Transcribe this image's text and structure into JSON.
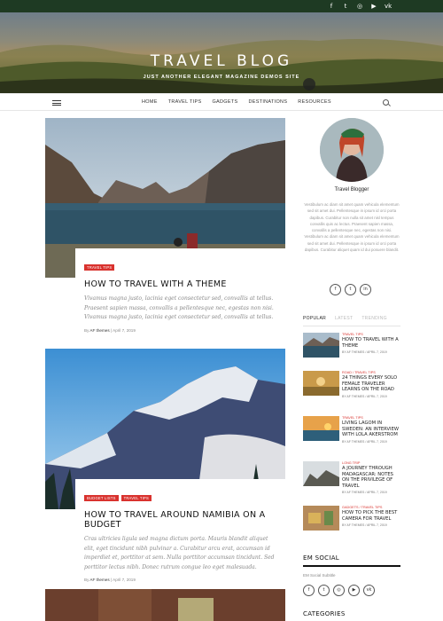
{
  "site": {
    "title": "TRAVEL BLOG",
    "tagline": "JUST ANOTHER ELEGANT MAGAZINE DEMOS SITE",
    "top_social_icons": [
      "facebook-icon",
      "twitter-icon",
      "instagram-icon",
      "youtube-icon",
      "vk-icon"
    ]
  },
  "nav": {
    "items": [
      "HOME",
      "TRAVEL TIPS",
      "GADGETS",
      "DESTINATIONS",
      "RESOURCES"
    ]
  },
  "posts": [
    {
      "tags": [
        "TRAVEL TIPS"
      ],
      "title": "HOW TO TRAVEL WITH A THEME",
      "excerpt": "Vivamus magna justo, lacinia eget consectetur sed, convallis at tellus. Praesent sapien massa, convallis a pellentesque nec, egestas non nisi. Vivamus magna justo, lacinia eget consectetur sed, convallis at tellus.",
      "author_prefix": "By",
      "author": "AF themes",
      "date": "April 7, 2019"
    },
    {
      "tags": [
        "BUDGET LISTS",
        "TRAVEL TIPS"
      ],
      "title": "HOW TO TRAVEL AROUND NAMIBIA ON A BUDGET",
      "excerpt": "Cras ultricies ligula sed magna dictum porta. Mauris blandit aliquet elit, eget tincidunt nibh pulvinar a. Curabitur arcu erat, accumsan id imperdiet et, porttitor at sem. Nulla porttitor accumsan tincidunt. Sed porttitor lectus nibh. Donec rutrum congue leo eget malesuada.",
      "author_prefix": "By",
      "author": "AF themes",
      "date": "April 7, 2019"
    }
  ],
  "sidebar": {
    "about": {
      "name": "Travel Blogger",
      "text": "Vestibulum ac diam sit amet quam vehicula elementum sed sit amet dui. Pellentesque in ipsum id orci porta dapibus. Curabitur non nulla sit amet nisl tempus convallis quis ac lectus. Praesent sapien massa, convallis a pellentesque nec, egestas non nisi. Vestibulum ac diam sit amet quam vehicula elementum sed sit amet dui. Pellentesque in ipsum id orci porta dapibus. Curabitur aliquet quam id dui posuere blandit.",
      "social_icons": [
        "facebook-icon",
        "twitter-icon",
        "linkedin-icon"
      ]
    },
    "tabs": [
      "POPULAR",
      "LATEST",
      "TRENDING"
    ],
    "popular": [
      {
        "cat": "TRAVEL TIPS",
        "title": "HOW TO TRAVEL WITH A THEME",
        "meta": "BY AF THEMES / APRIL 7, 2019"
      },
      {
        "cat": "ROAD / TRAVEL TIPS",
        "title": "24 THINGS EVERY SOLO FEMALE TRAVELER LEARNS ON THE ROAD",
        "meta": "BY AF THEMES / APRIL 7, 2019"
      },
      {
        "cat": "TRAVEL TIPS",
        "title": "LIVING LAGOM IN SWEDEN: AN INTERVIEW WITH LOLA AKERSTROM",
        "meta": "BY AF THEMES / APRIL 7, 2019"
      },
      {
        "cat": "LONG TRIP",
        "title": "A JOURNEY THROUGH MADAGASCAR: NOTES ON THE PRIVILEGE OF TRAVEL",
        "meta": "BY AF THEMES / APRIL 7, 2019"
      },
      {
        "cat": "GADGETS / TRAVEL TIPS",
        "title": "HOW TO PICK THE BEST CAMERA FOR TRAVEL",
        "meta": "BY AF THEMES / APRIL 7, 2019"
      }
    ],
    "em_social": {
      "title": "EM SOCIAL",
      "subtitle": "EM Social Subtitle",
      "icons": [
        "facebook-icon",
        "twitter-icon",
        "instagram-icon",
        "youtube-icon",
        "vk-icon"
      ]
    },
    "categories_title": "CATEGORIES"
  },
  "colors": {
    "accent": "#d9322e",
    "topbar": "#1e3a23"
  }
}
